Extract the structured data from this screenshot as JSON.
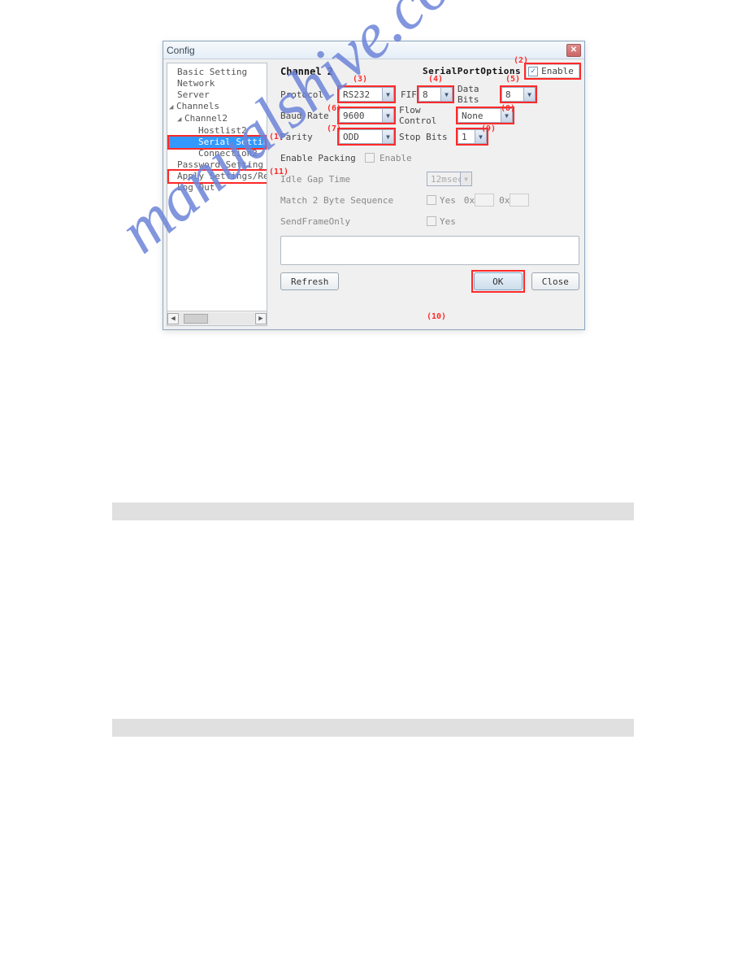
{
  "window": {
    "title": "Config",
    "close_glyph": "✕"
  },
  "tree": {
    "items": [
      {
        "label": "Basic Setting",
        "indent": 1
      },
      {
        "label": "Network",
        "indent": 1
      },
      {
        "label": "Server",
        "indent": 1
      },
      {
        "label": "Channels",
        "indent": 1,
        "expander": "◢"
      },
      {
        "label": "Channel2",
        "indent": 2,
        "expander": "◢"
      },
      {
        "label": "Hostlist2",
        "indent": 3
      },
      {
        "label": "Serial Settin",
        "indent": 3,
        "selected": true,
        "red": true
      },
      {
        "label": "Connection2",
        "indent": 3
      },
      {
        "label": "Password Setting",
        "indent": 1
      },
      {
        "label": "Apply Settings/Rest",
        "indent": 1,
        "red": true
      },
      {
        "label": "Log Out",
        "indent": 1
      }
    ],
    "scroll_left": "◀",
    "scroll_right": "▶"
  },
  "annotations": {
    "a1": "(1)",
    "a2": "(2)",
    "a3": "(3)",
    "a4": "(4)",
    "a5": "(5)",
    "a6": "(6)",
    "a7": "(7)",
    "a8": "(8)",
    "a9": "(9)",
    "a10": "(10)",
    "a11": "(11)"
  },
  "header": {
    "channel": "Channel 2",
    "serial_port_options": "SerialPortOptions",
    "enable_label": "Enable",
    "enable_check": "✓"
  },
  "fields": {
    "protocol_label": "Protocol",
    "protocol_value": "RS232",
    "fifo_label": "FIFO",
    "fifo_value": "8",
    "databits_label": "Data Bits",
    "databits_value": "8",
    "baud_label": "Baud Rate",
    "baud_value": "9600",
    "flow_label": "Flow Control",
    "flow_value": "None",
    "parity_label": "Parity",
    "parity_value": "ODD",
    "stopbits_label": "Stop Bits",
    "stopbits_value": "1",
    "enable_packing_label": "Enable Packing",
    "enable_packing_inner": "Enable",
    "idle_gap_label": "Idle Gap Time",
    "idle_gap_value": "12msec",
    "match2_label": "Match 2 Byte Sequence",
    "yes_label": "Yes",
    "ox_label": "0x",
    "sendframe_label": "SendFrameOnly"
  },
  "buttons": {
    "refresh": "Refresh",
    "ok": "OK",
    "close": "Close"
  },
  "drop_glyph": "▼"
}
